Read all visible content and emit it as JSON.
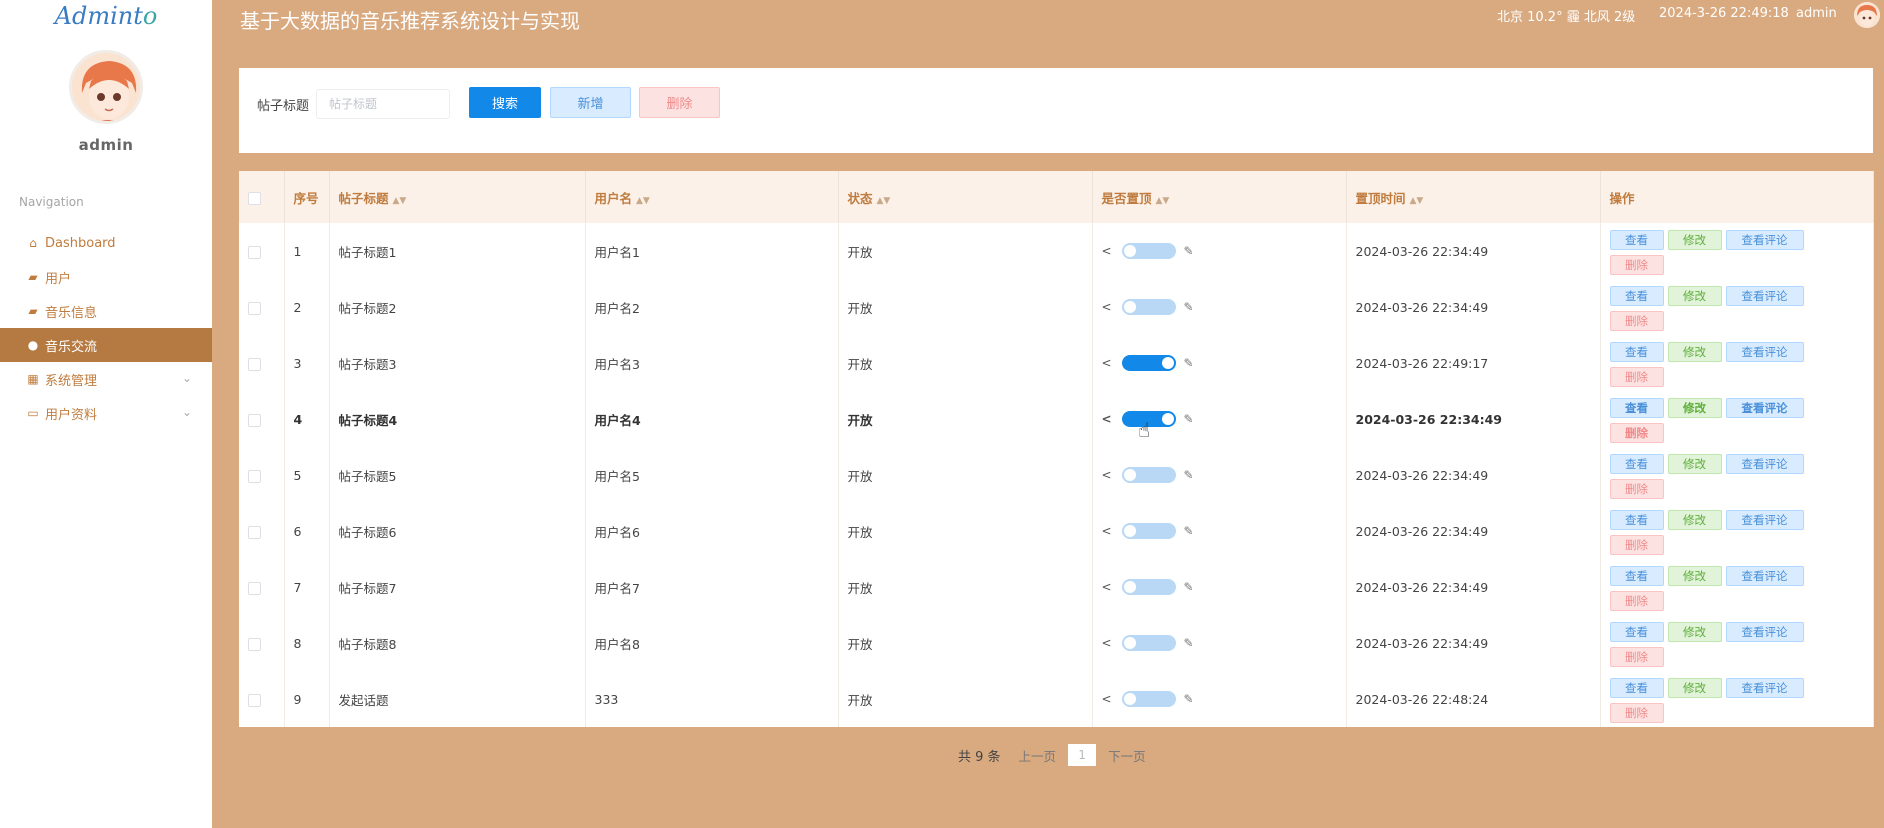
{
  "sidebar": {
    "logo": {
      "part1": "Admint",
      "part2": "o"
    },
    "user_name": "admin",
    "nav_title": "Navigation",
    "items": [
      {
        "label": "Dashboard",
        "icon": "home-icon"
      },
      {
        "label": "用户",
        "icon": "users-icon"
      },
      {
        "label": "音乐信息",
        "icon": "music-icon"
      },
      {
        "label": "音乐交流",
        "icon": "chat-icon",
        "active": true
      },
      {
        "label": "系统管理",
        "icon": "grid-icon"
      },
      {
        "label": "用户资料",
        "icon": "calendar-icon"
      }
    ]
  },
  "topbar": {
    "title": "基于大数据的音乐推荐系统设计与实现",
    "weather": "北京  10.2°  霾  北风  2级",
    "datetime": "2024-3-26 22:49:18",
    "user": "admin"
  },
  "search": {
    "label": "帖子标题",
    "placeholder": "帖子标题",
    "search_btn": "搜索",
    "add_btn": "新增",
    "delete_btn": "删除"
  },
  "table": {
    "headers": {
      "index": "序号",
      "title": "帖子标题",
      "username": "用户名",
      "status": "状态",
      "pinned": "是否置顶",
      "pin_time": "置顶时间",
      "actions": "操作"
    },
    "action_labels": {
      "view": "查看",
      "edit": "修改",
      "comments": "查看评论",
      "delete": "删除"
    },
    "rows": [
      {
        "index": "1",
        "title": "帖子标题1",
        "username": "用户名1",
        "status": "开放",
        "pinned": false,
        "pin_time": "2024-03-26 22:34:49"
      },
      {
        "index": "2",
        "title": "帖子标题2",
        "username": "用户名2",
        "status": "开放",
        "pinned": false,
        "pin_time": "2024-03-26 22:34:49"
      },
      {
        "index": "3",
        "title": "帖子标题3",
        "username": "用户名3",
        "status": "开放",
        "pinned": true,
        "pin_time": "2024-03-26 22:49:17"
      },
      {
        "index": "4",
        "title": "帖子标题4",
        "username": "用户名4",
        "status": "开放",
        "pinned": true,
        "pin_time": "2024-03-26 22:34:49"
      },
      {
        "index": "5",
        "title": "帖子标题5",
        "username": "用户名5",
        "status": "开放",
        "pinned": false,
        "pin_time": "2024-03-26 22:34:49"
      },
      {
        "index": "6",
        "title": "帖子标题6",
        "username": "用户名6",
        "status": "开放",
        "pinned": false,
        "pin_time": "2024-03-26 22:34:49"
      },
      {
        "index": "7",
        "title": "帖子标题7",
        "username": "用户名7",
        "status": "开放",
        "pinned": false,
        "pin_time": "2024-03-26 22:34:49"
      },
      {
        "index": "8",
        "title": "帖子标题8",
        "username": "用户名8",
        "status": "开放",
        "pinned": false,
        "pin_time": "2024-03-26 22:34:49"
      },
      {
        "index": "9",
        "title": "发起话题",
        "username": "333",
        "status": "开放",
        "pinned": false,
        "pin_time": "2024-03-26 22:48:24"
      }
    ]
  },
  "pager": {
    "total": "共 9 条",
    "prev": "上一页",
    "current": "1",
    "next": "下一页"
  },
  "colors": {
    "accent": "#b57a41",
    "primary": "#1288e8",
    "background": "#d9aa80"
  }
}
